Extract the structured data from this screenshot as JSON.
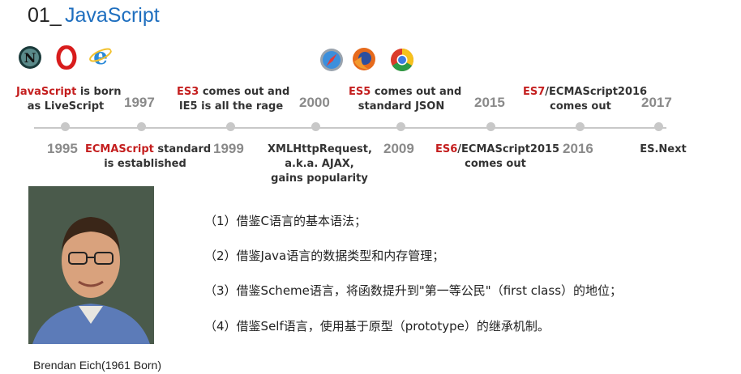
{
  "title": {
    "number": "01_",
    "name": "JavaScript"
  },
  "logos": [
    "netscape-icon",
    "opera-icon",
    "internet-explorer-icon",
    "safari-icon",
    "firefox-icon",
    "chrome-icon"
  ],
  "colors": {
    "accent": "#c41e1e",
    "title_blue": "#1f6fbf",
    "timeline": "#c8c8c8"
  },
  "timeline": {
    "years_top": [
      "1997",
      "2000",
      "2015",
      "2017"
    ],
    "years_bottom": [
      "1995",
      "1999",
      "2009",
      "2016"
    ],
    "events": [
      {
        "hl": "JavaScript",
        "rest": " is born",
        "line2": "as LiveScript"
      },
      {
        "hl": "ECMAScript",
        "rest": " standard",
        "line2": "is established"
      },
      {
        "hl": "ES3",
        "rest": " comes out and",
        "line2": "IE5 is all the rage"
      },
      {
        "hl": "",
        "rest": "XMLHttpRequest,",
        "line2": "a.k.a. AJAX,",
        "line3": "gains popularity"
      },
      {
        "hl": "ES5",
        "rest": " comes out and",
        "line2": "standard JSON"
      },
      {
        "hl": "ES6",
        "rest": "/ECMAScript2015",
        "line2": "comes out"
      },
      {
        "hl": "ES7",
        "rest": "/ECMAScript2016",
        "line2": "comes out"
      },
      {
        "hl": "",
        "rest": "ES.Next"
      }
    ]
  },
  "person": {
    "caption": "Brendan  Eich(1961 Born)"
  },
  "features": [
    "（1）借鉴C语言的基本语法；",
    "（2）借鉴Java语言的数据类型和内存管理；",
    "（3）借鉴Scheme语言，将函数提升到\"第一等公民\"（first class）的地位；",
    "（4）借鉴Self语言，使用基于原型（prototype）的继承机制。"
  ]
}
